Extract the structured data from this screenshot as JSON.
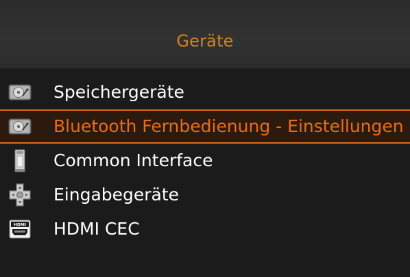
{
  "header": {
    "title": "Geräte"
  },
  "menu": {
    "items": [
      {
        "label": "Speichergeräte",
        "icon": "hard-drive-icon",
        "selected": false
      },
      {
        "label": "Bluetooth Fernbedienung - Einstellungen",
        "icon": "hard-drive-icon",
        "selected": true
      },
      {
        "label": "Common Interface",
        "icon": "ci-module-icon",
        "selected": false
      },
      {
        "label": "Eingabegeräte",
        "icon": "dpad-icon",
        "selected": false
      },
      {
        "label": "HDMI CEC",
        "icon": "hdmi-icon",
        "selected": false
      }
    ]
  },
  "colors": {
    "accent": "#e06a14",
    "title": "#d6811b",
    "selected_text": "#ec6a1a",
    "background": "#1b1b1b"
  }
}
